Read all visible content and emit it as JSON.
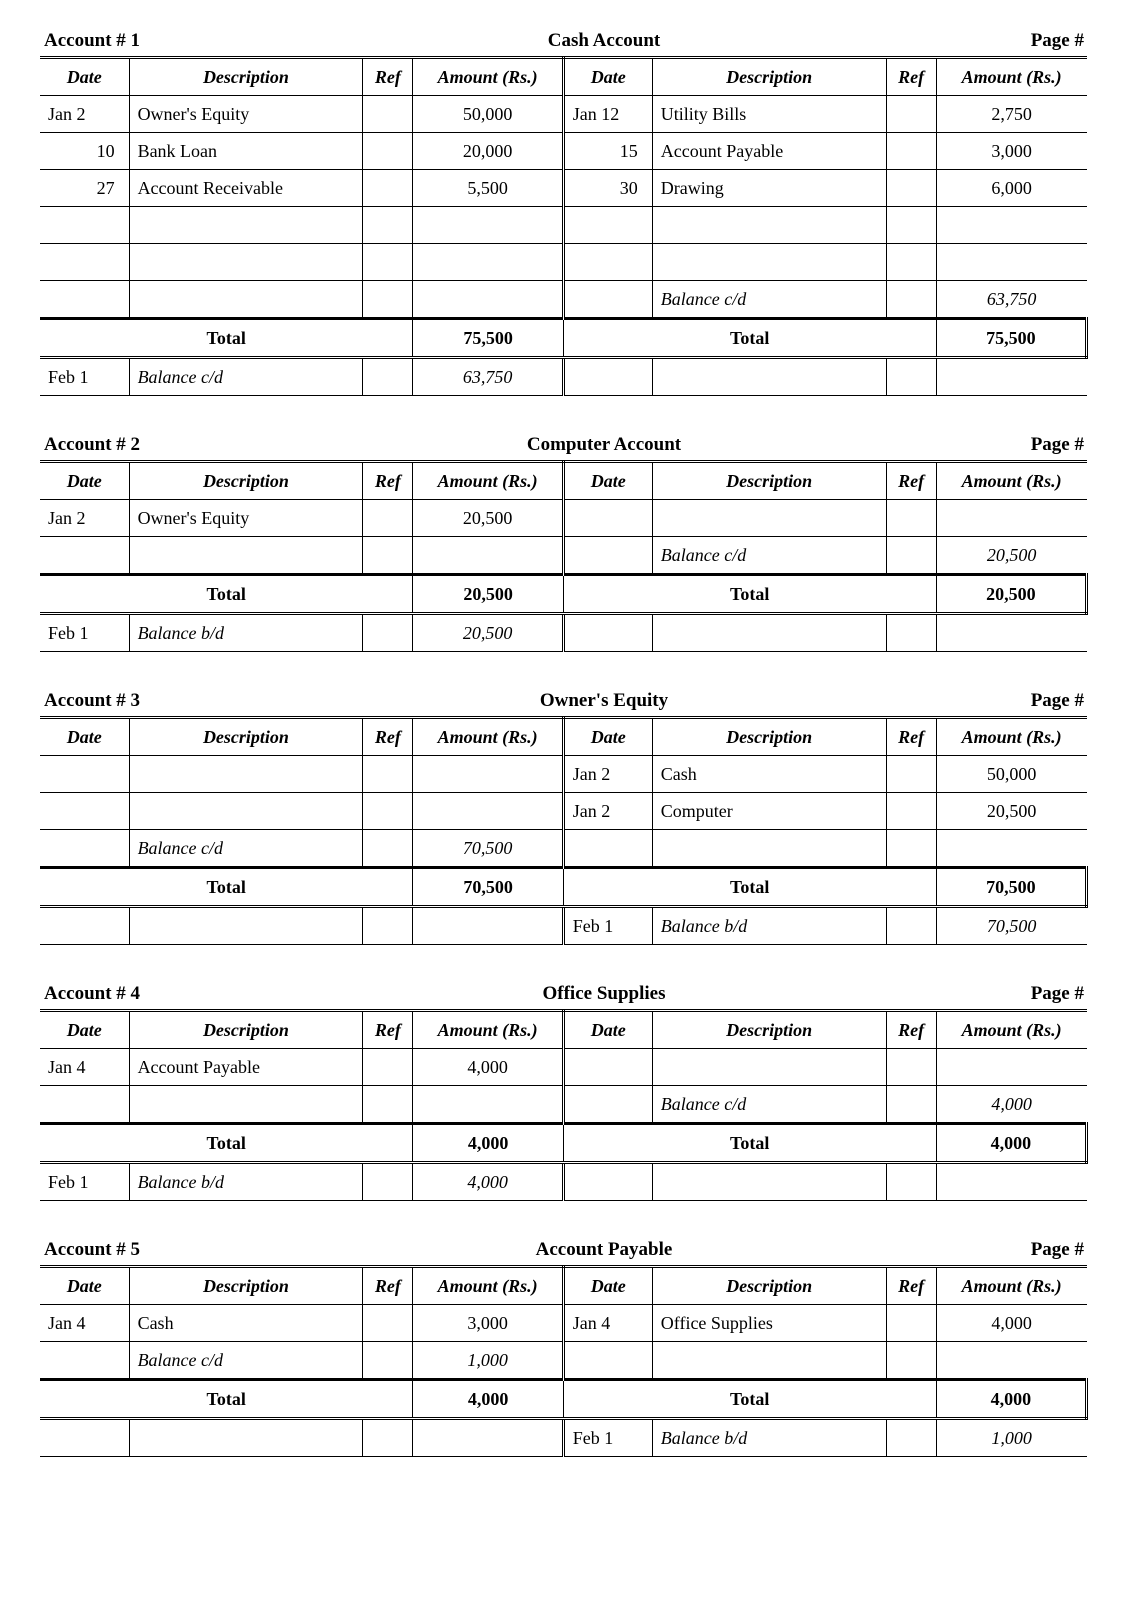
{
  "headers": {
    "date": "Date",
    "desc": "Description",
    "ref": "Ref",
    "amt": "Amount (Rs.)"
  },
  "total_label": "Total",
  "page_label": "Page #",
  "account_prefix": "Account  #",
  "accounts": [
    {
      "num": "1",
      "title": "Cash Account",
      "debit_rows": [
        {
          "date": "Jan 2",
          "desc": "Owner's Equity",
          "ref": "",
          "amt": "50,000"
        },
        {
          "date": "10",
          "desc": "Bank Loan",
          "ref": "",
          "amt": "20,000",
          "date_right": true
        },
        {
          "date": "27",
          "desc": "Account Receivable",
          "ref": "",
          "amt": "5,500",
          "date_right": true
        },
        {
          "date": "",
          "desc": "",
          "ref": "",
          "amt": ""
        },
        {
          "date": "",
          "desc": "",
          "ref": "",
          "amt": ""
        },
        {
          "date": "",
          "desc": "",
          "ref": "",
          "amt": ""
        }
      ],
      "credit_rows": [
        {
          "date": "Jan 12",
          "desc": "Utility Bills",
          "ref": "",
          "amt": "2,750"
        },
        {
          "date": "15",
          "desc": "Account Payable",
          "ref": "",
          "amt": "3,000",
          "date_right": true
        },
        {
          "date": "30",
          "desc": "Drawing",
          "ref": "",
          "amt": "6,000",
          "date_right": true
        },
        {
          "date": "",
          "desc": "",
          "ref": "",
          "amt": ""
        },
        {
          "date": "",
          "desc": "",
          "ref": "",
          "amt": ""
        },
        {
          "date": "",
          "desc": "Balance c/d",
          "ref": "",
          "amt": "63,750",
          "italic": true
        }
      ],
      "debit_total": "75,500",
      "credit_total": "75,500",
      "post_rows": [
        {
          "d_date": "Feb 1",
          "d_desc": "Balance c/d",
          "d_ref": "",
          "d_amt": "63,750",
          "d_italic": true,
          "c_date": "",
          "c_desc": "",
          "c_ref": "",
          "c_amt": ""
        }
      ]
    },
    {
      "num": "2",
      "title": "Computer  Account",
      "debit_rows": [
        {
          "date": "Jan 2",
          "desc": "Owner's Equity",
          "ref": "",
          "amt": "20,500"
        },
        {
          "date": "",
          "desc": "",
          "ref": "",
          "amt": ""
        }
      ],
      "credit_rows": [
        {
          "date": "",
          "desc": "",
          "ref": "",
          "amt": ""
        },
        {
          "date": "",
          "desc": "Balance c/d",
          "ref": "",
          "amt": "20,500",
          "italic": true
        }
      ],
      "debit_total": "20,500",
      "credit_total": "20,500",
      "post_rows": [
        {
          "d_date": "Feb 1",
          "d_desc": "Balance b/d",
          "d_ref": "",
          "d_amt": "20,500",
          "d_italic": true,
          "c_date": "",
          "c_desc": "",
          "c_ref": "",
          "c_amt": ""
        }
      ]
    },
    {
      "num": "3",
      "title": "Owner's Equity",
      "debit_rows": [
        {
          "date": "",
          "desc": "",
          "ref": "",
          "amt": ""
        },
        {
          "date": "",
          "desc": "",
          "ref": "",
          "amt": ""
        },
        {
          "date": "",
          "desc": "Balance c/d",
          "ref": "",
          "amt": "70,500",
          "italic": true
        }
      ],
      "credit_rows": [
        {
          "date": "Jan 2",
          "desc": "Cash",
          "ref": "",
          "amt": "50,000"
        },
        {
          "date": "Jan 2",
          "desc": "Computer",
          "ref": "",
          "amt": "20,500"
        },
        {
          "date": "",
          "desc": "",
          "ref": "",
          "amt": ""
        }
      ],
      "debit_total": "70,500",
      "credit_total": "70,500",
      "post_rows": [
        {
          "d_date": "",
          "d_desc": "",
          "d_ref": "",
          "d_amt": "",
          "c_date": "Feb 1",
          "c_desc": "Balance b/d",
          "c_ref": "",
          "c_amt": "70,500",
          "c_italic": true
        }
      ]
    },
    {
      "num": "4",
      "title": "Office Supplies",
      "debit_rows": [
        {
          "date": "Jan 4",
          "desc": "Account Payable",
          "ref": "",
          "amt": "4,000"
        },
        {
          "date": "",
          "desc": "",
          "ref": "",
          "amt": ""
        }
      ],
      "credit_rows": [
        {
          "date": "",
          "desc": "",
          "ref": "",
          "amt": ""
        },
        {
          "date": "",
          "desc": "Balance c/d",
          "ref": "",
          "amt": "4,000",
          "italic": true
        }
      ],
      "debit_total": "4,000",
      "credit_total": "4,000",
      "post_rows": [
        {
          "d_date": "Feb 1",
          "d_desc": "Balance b/d",
          "d_ref": "",
          "d_amt": "4,000",
          "d_italic": true,
          "c_date": "",
          "c_desc": "",
          "c_ref": "",
          "c_amt": ""
        }
      ]
    },
    {
      "num": "5",
      "title": "Account Payable",
      "debit_rows": [
        {
          "date": "Jan 4",
          "desc": "Cash",
          "ref": "",
          "amt": "3,000"
        },
        {
          "date": "",
          "desc": "Balance c/d",
          "ref": "",
          "amt": "1,000",
          "italic": true
        }
      ],
      "credit_rows": [
        {
          "date": "Jan 4",
          "desc": "Office Supplies",
          "ref": "",
          "amt": "4,000"
        },
        {
          "date": "",
          "desc": "",
          "ref": "",
          "amt": ""
        }
      ],
      "debit_total": "4,000",
      "credit_total": "4,000",
      "post_rows": [
        {
          "d_date": "",
          "d_desc": "",
          "d_ref": "",
          "d_amt": "",
          "c_date": "Feb 1",
          "c_desc": "Balance b/d",
          "c_ref": "",
          "c_amt": "1,000",
          "c_italic": true
        }
      ]
    }
  ]
}
